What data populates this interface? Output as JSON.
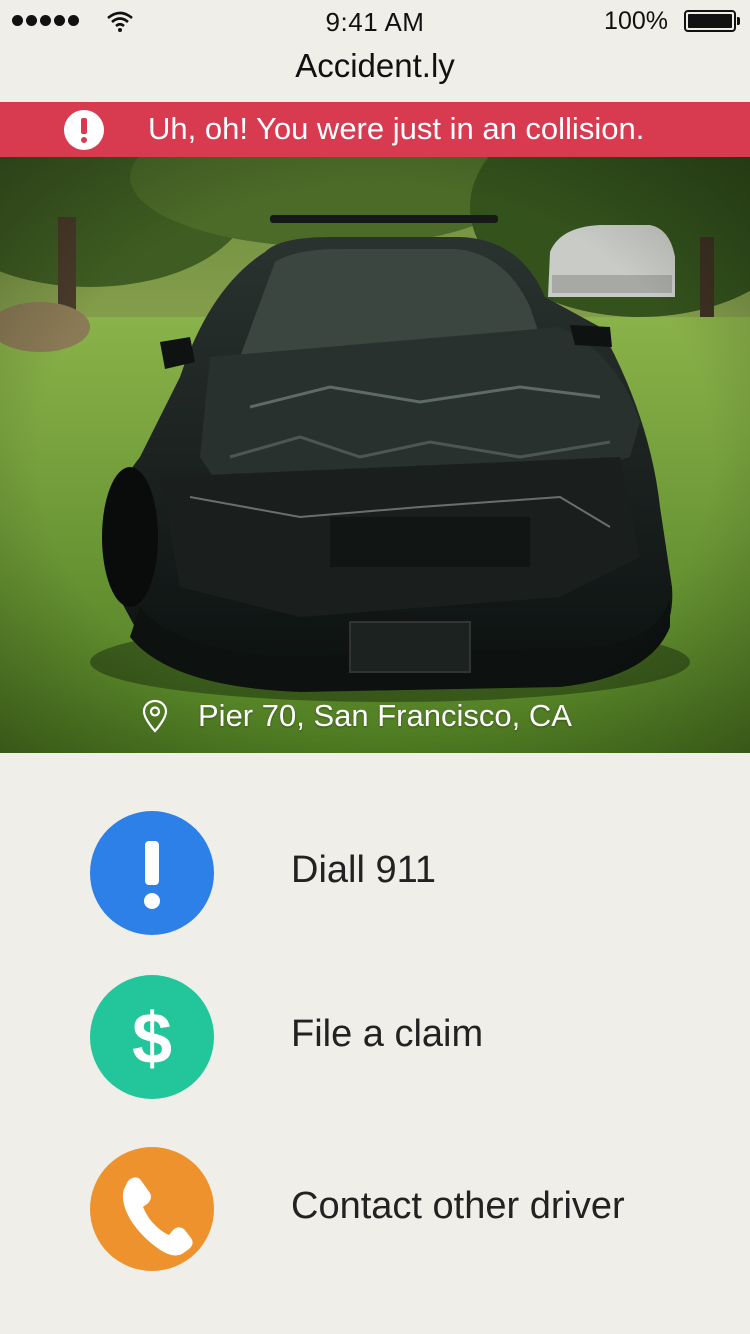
{
  "status_bar": {
    "time": "9:41 AM",
    "battery": "100%"
  },
  "app": {
    "title": "Accident.ly"
  },
  "alert": {
    "text": "Uh, oh! You were just in an collision.",
    "color": "#d83a4f",
    "icon": "exclamation-icon"
  },
  "incident": {
    "location": "Pier 70, San Francisco, CA",
    "location_icon": "map-pin-icon"
  },
  "actions": [
    {
      "label": "Diall 911",
      "icon": "exclamation-icon",
      "color": "#2c80e8"
    },
    {
      "label": "File a claim",
      "icon": "dollar-icon",
      "color": "#22c69a"
    },
    {
      "label": "Contact other driver",
      "icon": "phone-icon",
      "color": "#ee922d"
    }
  ]
}
